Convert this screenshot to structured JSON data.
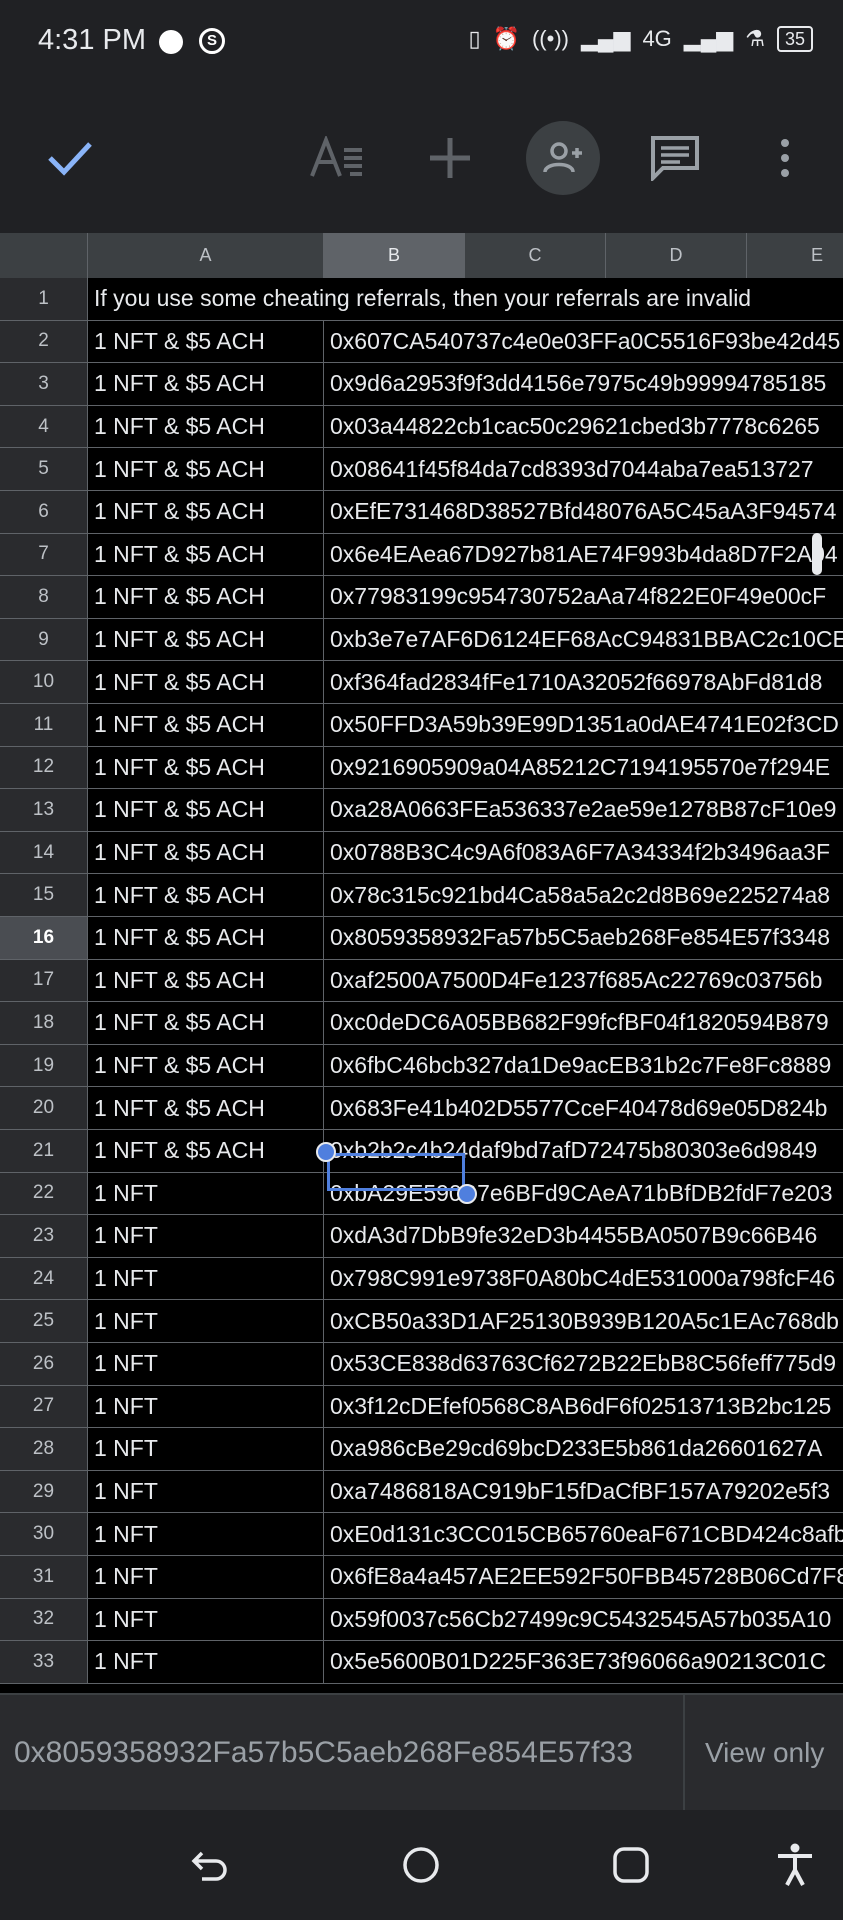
{
  "status_bar": {
    "time": "4:31 PM",
    "network": "4G",
    "battery": "35"
  },
  "columns": [
    "A",
    "B",
    "C",
    "D",
    "E"
  ],
  "rows": [
    {
      "num": "1",
      "a": "If you use some cheating referrals, then your referrals are invalid",
      "b": ""
    },
    {
      "num": "2",
      "a": "1 NFT & $5 ACH",
      "b": "0x607CA540737c4e0e03FFa0C5516F93be42d45"
    },
    {
      "num": "3",
      "a": "1 NFT & $5 ACH",
      "b": "0x9d6a2953f9f3dd4156e7975c49b99994785185"
    },
    {
      "num": "4",
      "a": "1 NFT & $5 ACH",
      "b": "0x03a44822cb1cac50c29621cbed3b7778c6265"
    },
    {
      "num": "5",
      "a": "1 NFT & $5 ACH",
      "b": "0x08641f45f84da7cd8393d7044aba7ea513727"
    },
    {
      "num": "6",
      "a": "1 NFT & $5 ACH",
      "b": "0xEfE731468D38527Bfd48076A5C45aA3F94574"
    },
    {
      "num": "7",
      "a": "1 NFT & $5 ACH",
      "b": "0x6e4EAea67D927b81AE74F993b4da8D7F2A04"
    },
    {
      "num": "8",
      "a": "1 NFT & $5 ACH",
      "b": "0x77983199c954730752aAa74f822E0F49e00cF"
    },
    {
      "num": "9",
      "a": "1 NFT & $5 ACH",
      "b": "0xb3e7e7AF6D6124EF68AcC94831BBAC2c10CE"
    },
    {
      "num": "10",
      "a": "1 NFT & $5 ACH",
      "b": "0xf364fad2834fFe1710A32052f66978AbFd81d8"
    },
    {
      "num": "11",
      "a": "1 NFT & $5 ACH",
      "b": "0x50FFD3A59b39E99D1351a0dAE4741E02f3CD"
    },
    {
      "num": "12",
      "a": "1 NFT & $5 ACH",
      "b": "0x9216905909a04A85212C7194195570e7f294E"
    },
    {
      "num": "13",
      "a": "1 NFT & $5 ACH",
      "b": "0xa28A0663FEa536337e2ae59e1278B87cF10e9"
    },
    {
      "num": "14",
      "a": "1 NFT & $5 ACH",
      "b": "0x0788B3C4c9A6f083A6F7A34334f2b3496aa3F"
    },
    {
      "num": "15",
      "a": "1 NFT & $5 ACH",
      "b": "0x78c315c921bd4Ca58a5a2c2d8B69e225274a8"
    },
    {
      "num": "16",
      "a": "1 NFT & $5 ACH",
      "b": "0x8059358932Fa57b5C5aeb268Fe854E57f3348"
    },
    {
      "num": "17",
      "a": "1 NFT & $5 ACH",
      "b": "0xaf2500A7500D4Fe1237f685Ac22769c03756b"
    },
    {
      "num": "18",
      "a": "1 NFT & $5 ACH",
      "b": "0xc0deDC6A05BB682F99fcfBF04f1820594B879"
    },
    {
      "num": "19",
      "a": "1 NFT & $5 ACH",
      "b": "0x6fbC46bcb327da1De9acEB31b2c7Fe8Fc8889"
    },
    {
      "num": "20",
      "a": "1 NFT & $5 ACH",
      "b": "0x683Fe41b402D5577CceF40478d69e05D824b"
    },
    {
      "num": "21",
      "a": "1 NFT & $5 ACH",
      "b": "0xb2b2c4b24daf9bd7afD72475b80303e6d9849"
    },
    {
      "num": "22",
      "a": "1 NFT",
      "b": "0xbA29E590B7e6BFd9CAeA71bBfDB2fdF7e203"
    },
    {
      "num": "23",
      "a": "1 NFT",
      "b": "0xdA3d7DbB9fe32eD3b4455BA0507B9c66B46"
    },
    {
      "num": "24",
      "a": "1 NFT",
      "b": "0x798C991e9738F0A80bC4dE531000a798fcF46"
    },
    {
      "num": "25",
      "a": "1 NFT",
      "b": "0xCB50a33D1AF25130B939B120A5c1EAc768db"
    },
    {
      "num": "26",
      "a": "1 NFT",
      "b": "0x53CE838d63763Cf6272B22EbB8C56feff775d9"
    },
    {
      "num": "27",
      "a": "1 NFT",
      "b": "0x3f12cDEfef0568C8AB6dF6f02513713B2bc125"
    },
    {
      "num": "28",
      "a": "1 NFT",
      "b": "0xa986cBe29cd69bcD233E5b861da26601627A"
    },
    {
      "num": "29",
      "a": "1 NFT",
      "b": "0xa7486818AC919bF15fDaCfBF157A79202e5f3"
    },
    {
      "num": "30",
      "a": "1 NFT",
      "b": "0xE0d131c3CC015CB65760eaF671CBD424c8afb"
    },
    {
      "num": "31",
      "a": "1 NFT",
      "b": "0x6fE8a4a457AE2EE592F50FBB45728B06Cd7F8"
    },
    {
      "num": "32",
      "a": "1 NFT",
      "b": "0x59f0037c56Cb27499c9C5432545A57b035A10"
    },
    {
      "num": "33",
      "a": "1 NFT",
      "b": "0x5e5600B01D225F363E73f96066a90213C01C"
    }
  ],
  "selected_row": "16",
  "formula_bar": {
    "value": "0x8059358932Fa57b5C5aeb268Fe854E57f33",
    "mode": "View only"
  },
  "colors": {
    "accent": "#4f7fde",
    "check": "#8ab4f8",
    "toolbar_bg": "#202124",
    "header_bg": "#3c4043"
  }
}
